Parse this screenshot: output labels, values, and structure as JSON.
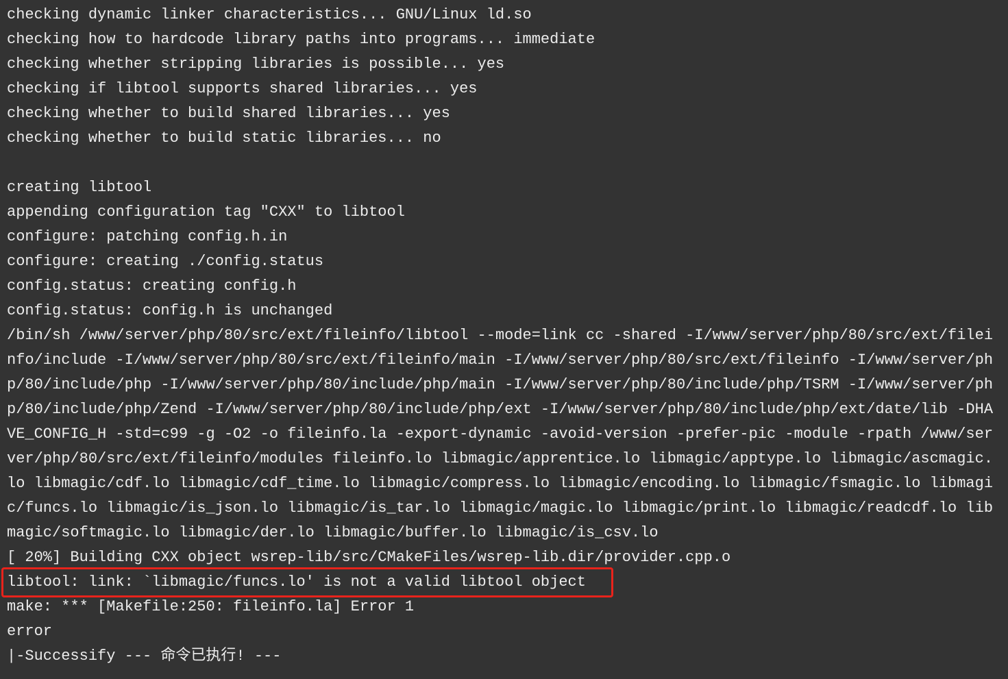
{
  "terminal": {
    "lines": [
      "checking dynamic linker characteristics... GNU/Linux ld.so",
      "checking how to hardcode library paths into programs... immediate",
      "checking whether stripping libraries is possible... yes",
      "checking if libtool supports shared libraries... yes",
      "checking whether to build shared libraries... yes",
      "checking whether to build static libraries... no",
      "",
      "creating libtool",
      "appending configuration tag \"CXX\" to libtool",
      "configure: patching config.h.in",
      "configure: creating ./config.status",
      "config.status: creating config.h",
      "config.status: config.h is unchanged",
      "/bin/sh /www/server/php/80/src/ext/fileinfo/libtool --mode=link cc -shared -I/www/server/php/80/src/ext/filei",
      "nfo/include -I/www/server/php/80/src/ext/fileinfo/main -I/www/server/php/80/src/ext/fileinfo -I/www/server/ph",
      "p/80/include/php -I/www/server/php/80/include/php/main -I/www/server/php/80/include/php/TSRM -I/www/server/ph",
      "p/80/include/php/Zend -I/www/server/php/80/include/php/ext -I/www/server/php/80/include/php/ext/date/lib -DHA",
      "VE_CONFIG_H -std=c99 -g -O2 -o fileinfo.la -export-dynamic -avoid-version -prefer-pic -module -rpath /www/ser",
      "ver/php/80/src/ext/fileinfo/modules fileinfo.lo libmagic/apprentice.lo libmagic/apptype.lo libmagic/ascmagic.",
      "lo libmagic/cdf.lo libmagic/cdf_time.lo libmagic/compress.lo libmagic/encoding.lo libmagic/fsmagic.lo libmagi",
      "c/funcs.lo libmagic/is_json.lo libmagic/is_tar.lo libmagic/magic.lo libmagic/print.lo libmagic/readcdf.lo lib",
      "magic/softmagic.lo libmagic/der.lo libmagic/buffer.lo libmagic/is_csv.lo",
      "[ 20%] Building CXX object wsrep-lib/src/CMakeFiles/wsrep-lib.dir/provider.cpp.o",
      "libtool: link: `libmagic/funcs.lo' is not a valid libtool object",
      "make: *** [Makefile:250: fileinfo.la] Error 1",
      "error",
      "|-Successify --- 命令已执行! ---"
    ],
    "highlighted_line": 23,
    "colors": {
      "background": "#333333",
      "text": "#ececec",
      "highlight_border": "#e8231b"
    }
  }
}
